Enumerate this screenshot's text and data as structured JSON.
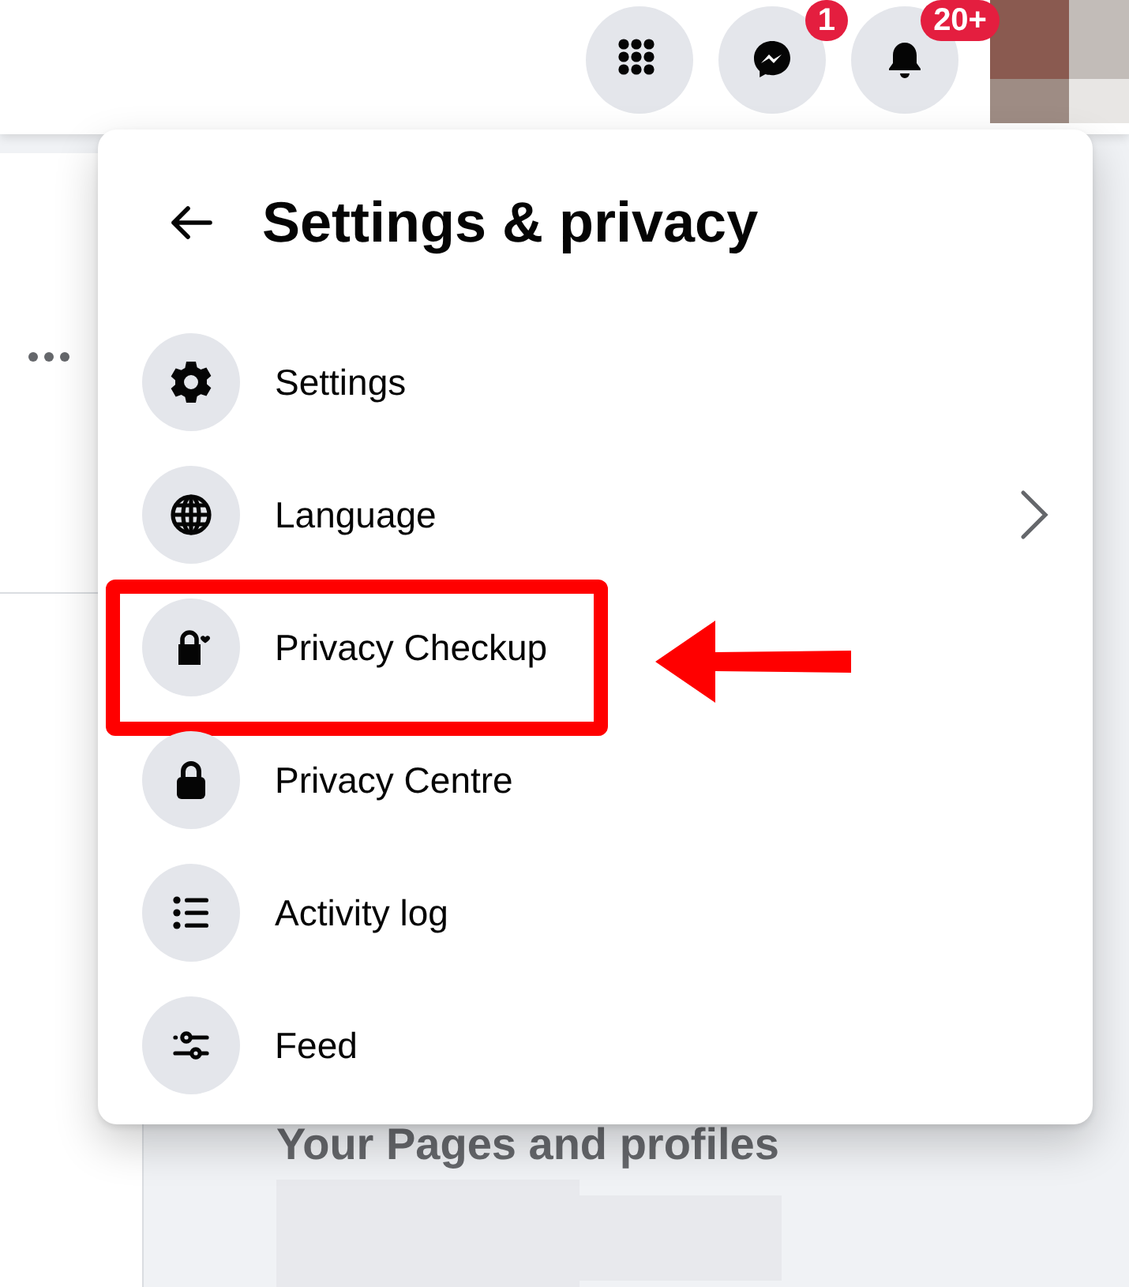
{
  "top_bar": {
    "buttons": [
      {
        "kind": "apps"
      },
      {
        "kind": "messenger",
        "badge": "1"
      },
      {
        "kind": "notifications",
        "badge": "20+"
      }
    ]
  },
  "background": {
    "section_title": "Your Pages and profiles"
  },
  "menu": {
    "title": "Settings & privacy",
    "items": [
      {
        "label": "Settings",
        "submenu": false,
        "highlighted": false
      },
      {
        "label": "Language",
        "submenu": true,
        "highlighted": false
      },
      {
        "label": "Privacy Checkup",
        "submenu": false,
        "highlighted": true
      },
      {
        "label": "Privacy Centre",
        "submenu": false,
        "highlighted": false
      },
      {
        "label": "Activity log",
        "submenu": false,
        "highlighted": false
      },
      {
        "label": "Feed",
        "submenu": false,
        "highlighted": false
      }
    ]
  }
}
